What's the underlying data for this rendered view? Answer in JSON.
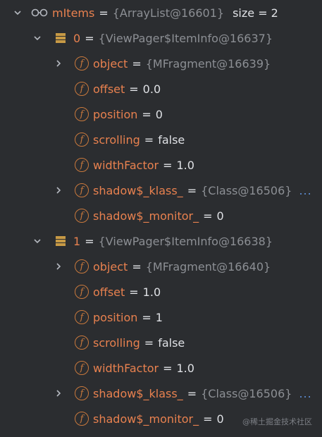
{
  "root": {
    "name": "mItems",
    "eq": "=",
    "ref": "{ArrayList@16601}",
    "size_label": "size = 2"
  },
  "items": [
    {
      "name": "0",
      "eq": "=",
      "ref": "{ViewPager$ItemInfo@16637}",
      "fields": [
        {
          "name": "object",
          "eq": "=",
          "ref": "{MFragment@16639}"
        },
        {
          "name": "offset",
          "eq": "=",
          "value": "0.0"
        },
        {
          "name": "position",
          "eq": "=",
          "value": "0"
        },
        {
          "name": "scrolling",
          "eq": "=",
          "value": "false"
        },
        {
          "name": "widthFactor",
          "eq": "=",
          "value": "1.0"
        },
        {
          "name": "shadow$_klass_",
          "eq": "=",
          "ref": "{Class@16506}",
          "ellipsis": "..."
        },
        {
          "name": "shadow$_monitor_",
          "eq": "=",
          "value": "0"
        }
      ]
    },
    {
      "name": "1",
      "eq": "=",
      "ref": "{ViewPager$ItemInfo@16638}",
      "fields": [
        {
          "name": "object",
          "eq": "=",
          "ref": "{MFragment@16640}"
        },
        {
          "name": "offset",
          "eq": "=",
          "value": "1.0"
        },
        {
          "name": "position",
          "eq": "=",
          "value": "1"
        },
        {
          "name": "scrolling",
          "eq": "=",
          "value": "false"
        },
        {
          "name": "widthFactor",
          "eq": "=",
          "value": "1.0"
        },
        {
          "name": "shadow$_klass_",
          "eq": "=",
          "ref": "{Class@16506}",
          "ellipsis": "..."
        },
        {
          "name": "shadow$_monitor_",
          "eq": "=",
          "value": "0"
        }
      ]
    }
  ],
  "field_icon_letter": "f",
  "watermark": "@稀土掘金技术社区",
  "colors": {
    "background": "#2b2d30",
    "field_name": "#e8814f",
    "reference": "#8c8f94",
    "value": "#dfe1e5",
    "ellipsis": "#5e8fd8",
    "field_icon": "#c9793d"
  }
}
